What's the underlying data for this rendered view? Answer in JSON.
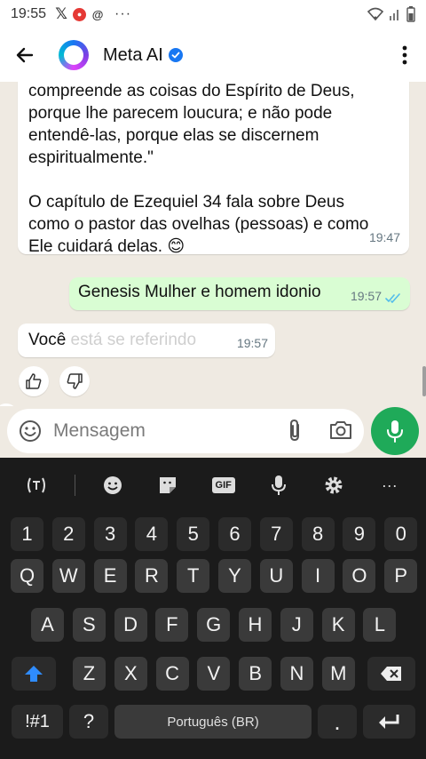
{
  "status_bar": {
    "time": "19:55",
    "icons": [
      "x-icon",
      "notification-icon",
      "threads-icon",
      "more-icon",
      "wifi-icon",
      "signal-icon",
      "battery-icon"
    ],
    "more_dots": "···"
  },
  "header": {
    "name": "Meta AI",
    "verified": true,
    "accent": "#1877f2"
  },
  "messages": [
    {
      "direction": "in",
      "lines_a": [
        "compreende as coisas do Espírito de Deus,",
        "porque lhe parecem loucura; e não pode",
        "entendê-las, porque elas se discernem",
        "espiritualmente.\""
      ],
      "lines_b": [
        "O capítulo de Ezequiel 34 fala sobre Deus",
        "como o pastor das ovelhas (pessoas) e como",
        "Ele cuidará delas. 😊"
      ],
      "time": "19:47"
    },
    {
      "direction": "out",
      "text": "Genesis Mulher e homem idonio",
      "time": "19:57",
      "status": "read"
    },
    {
      "direction": "in",
      "text_visible": "Você",
      "text_fading": " está se referindo",
      "time": "19:57"
    }
  ],
  "composer": {
    "placeholder": "Mensagem"
  },
  "keyboard": {
    "toolbar": [
      "translate-icon",
      "emoji-icon",
      "sticker-icon",
      "gif-icon",
      "voice-icon",
      "settings-icon",
      "more-icon"
    ],
    "gif_label": "GIF",
    "more_label": "···",
    "rows": [
      [
        "1",
        "2",
        "3",
        "4",
        "5",
        "6",
        "7",
        "8",
        "9",
        "0"
      ],
      [
        "Q",
        "W",
        "E",
        "R",
        "T",
        "Y",
        "U",
        "I",
        "O",
        "P"
      ],
      [
        "A",
        "S",
        "D",
        "F",
        "G",
        "H",
        "J",
        "K",
        "L"
      ],
      [
        "Z",
        "X",
        "C",
        "V",
        "B",
        "N",
        "M"
      ]
    ],
    "symbols_label": "!#1",
    "question_label": "?",
    "space_label": "Português (BR)",
    "period_label": "."
  },
  "colors": {
    "outgoing_bubble": "#d9fdd3",
    "incoming_bubble": "#ffffff",
    "chat_background": "#efeae2",
    "mic_button": "#1faa59",
    "read_ticks": "#53bdeb",
    "keyboard_bg": "#1b1b1b",
    "shift_active": "#2f8cff"
  }
}
